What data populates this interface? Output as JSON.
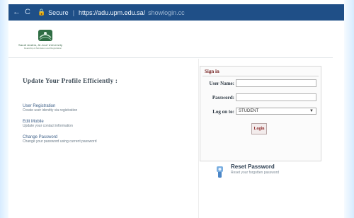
{
  "browser": {
    "back_glyph": "←",
    "reload_glyph": "C",
    "secure_label": "Secure",
    "separator": "|",
    "url_main": "https://adu.upm.edu.sa/",
    "url_rest": "showlogin.cc"
  },
  "logo": {
    "line1": "Saudi Arabia, Al-Jouf University",
    "line2": "Deanship of Admission and Registration"
  },
  "left": {
    "headline": "Update Your Profile Efficiently :",
    "links": [
      {
        "title": "User Registration",
        "desc": "Create user identity via registration"
      },
      {
        "title": "Edit Mobile",
        "desc": "Update your contact information"
      },
      {
        "title": "Change Password",
        "desc": "Change your password using current password"
      }
    ]
  },
  "signin": {
    "title": "Sign in",
    "username_label": "User Name:",
    "password_label": "Password:",
    "logon_label": "Log on to:",
    "logon_value": "STUDENT",
    "login_button": "Login"
  },
  "reset": {
    "title": "Reset Password",
    "desc": "Reset your forgotten password"
  }
}
